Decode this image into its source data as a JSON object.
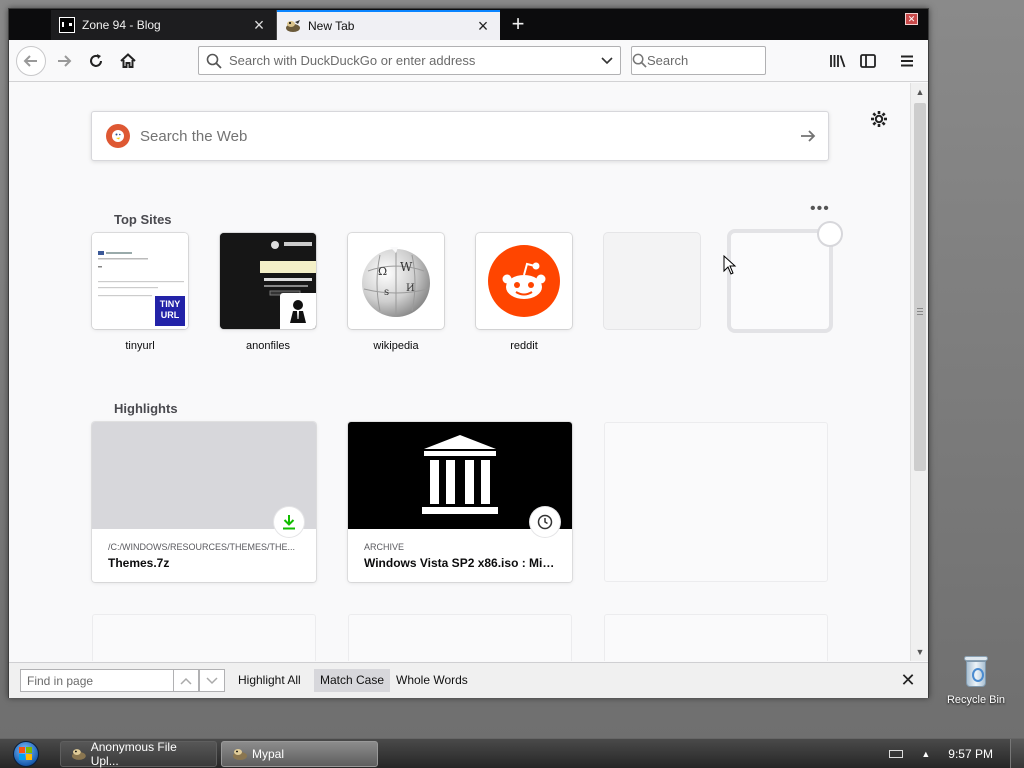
{
  "desktop": {
    "recycle_bin_label": "Recycle Bin"
  },
  "browser": {
    "tabs": [
      {
        "title": "Zone 94 - Blog",
        "active": false
      },
      {
        "title": "New Tab",
        "active": true
      }
    ],
    "urlbar_placeholder": "Search with DuckDuckGo or enter address",
    "searchbar_placeholder": "Search",
    "newtab": {
      "web_search_placeholder": "Search the Web",
      "top_sites_title": "Top Sites",
      "top_sites": [
        {
          "label": "tinyurl",
          "badge": "TINY URL"
        },
        {
          "label": "anonfiles"
        },
        {
          "label": "wikipedia"
        },
        {
          "label": "reddit"
        }
      ],
      "highlights_title": "Highlights",
      "highlights": [
        {
          "context": "/C:/WINDOWS/RESOURCES/THEMES/THE...",
          "title": "Themes.7z"
        },
        {
          "context": "ARCHIVE",
          "title": "Windows Vista SP2 x86.iso : Micr..."
        }
      ]
    },
    "findbar": {
      "placeholder": "Find in page",
      "highlight_all": "Highlight All",
      "match_case": "Match Case",
      "whole_words": "Whole Words"
    },
    "accent_color": "#0a84ff",
    "reddit_color": "#ff4500",
    "download_color": "#12bc00"
  },
  "taskbar": {
    "items": [
      {
        "label": "Anonymous File Upl...",
        "active": false
      },
      {
        "label": "Mypal",
        "active": true
      }
    ],
    "clock": "9:57 PM"
  }
}
